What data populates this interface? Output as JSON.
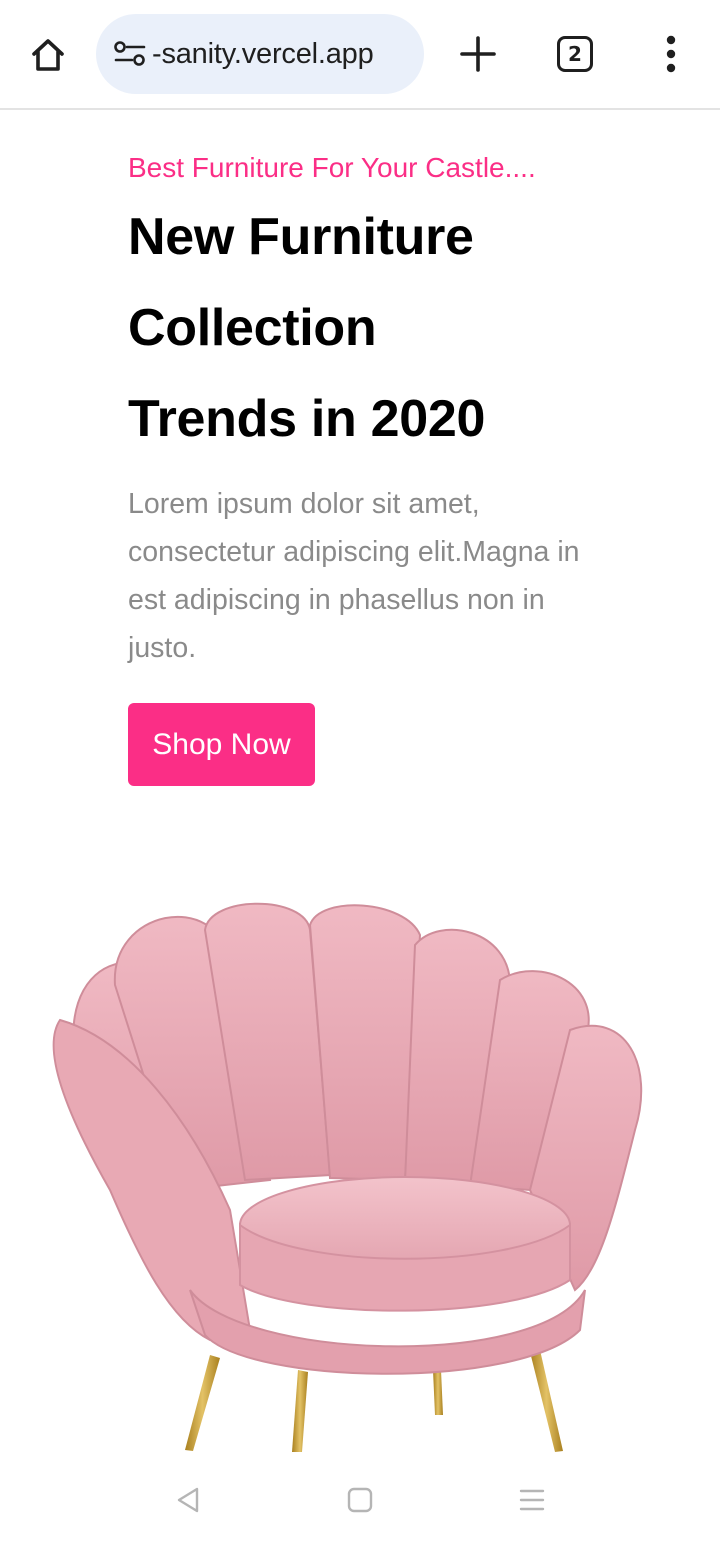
{
  "browser": {
    "url": "-sanity.vercel.app",
    "tab_count": "2",
    "icons": {
      "home": "home-icon",
      "site_settings": "site-settings-icon",
      "new_tab": "plus-icon",
      "tabs": "tab-switcher-icon",
      "menu": "more-vertical-icon"
    }
  },
  "hero": {
    "tagline": "Best Furniture For Your Castle....",
    "headline_lines": [
      "New Furniture",
      "Collection",
      "Trends in 2020"
    ],
    "description": "Lorem ipsum dolor sit amet, consectetur adipiscing elit.Magna in est adipiscing in phasellus non in justo.",
    "cta_label": "Shop Now",
    "image": "pink-armchair-image"
  },
  "system_nav": {
    "icons": [
      "back-icon",
      "home-square-icon",
      "recents-icon"
    ]
  },
  "colors": {
    "accent": "#fb2e86",
    "headline": "#000000",
    "body_text": "#8a8a8a",
    "url_pill": "#eaf0fa",
    "chair_pink": "#e8a9b4",
    "chair_legs": "#c9a23a"
  }
}
